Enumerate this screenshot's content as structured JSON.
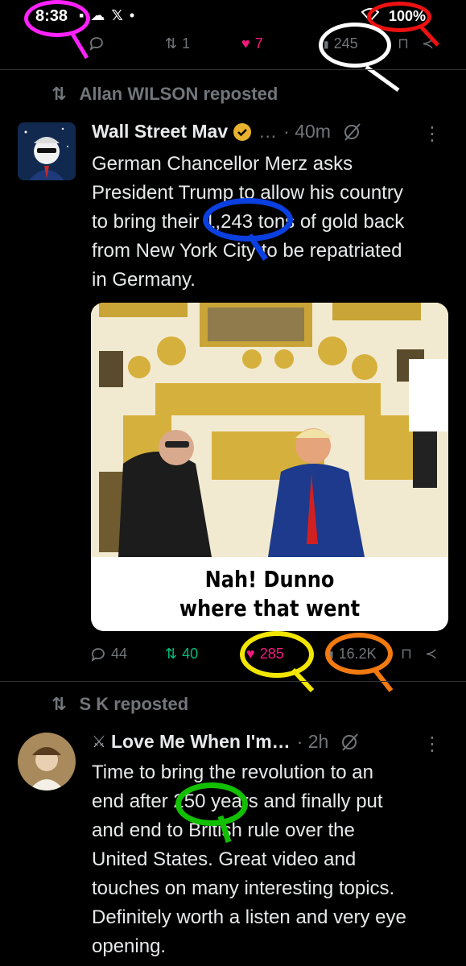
{
  "status_bar": {
    "time": "8:38",
    "battery": "100%"
  },
  "top_actions": {
    "replies": "",
    "reposts": "1",
    "likes": "7",
    "views": "245"
  },
  "tweet1": {
    "repost_label": "Allan WILSON reposted",
    "author": "Wall Street Mav",
    "ellipsis": "…",
    "time": "· 40m",
    "text": "German Chancellor Merz asks\nPresident Trump to allow his country\nto bring their 1,243 tons of gold back\nfrom New York City to be repatriated\nin Germany.",
    "image_caption": "Nah! Dunno\nwhere that went",
    "replies": "44",
    "reposts": "40",
    "likes": "285",
    "views": "16.2K"
  },
  "tweet2": {
    "repost_label": "S K reposted",
    "author": "Love Me When I'm…",
    "time": "· 2h",
    "text": "Time to bring the revolution to an\nend after 250 years and finally put\nand end to British rule over the\nUnited States. Great video and\ntouches on many interesting topics.\nDefinitely worth a listen and very eye\nopening."
  },
  "colors": {
    "green": "#00ba7c",
    "pink": "#f91880",
    "muted": "#71767b",
    "gold": "#d6b03c",
    "verified": "#e8b22f"
  }
}
